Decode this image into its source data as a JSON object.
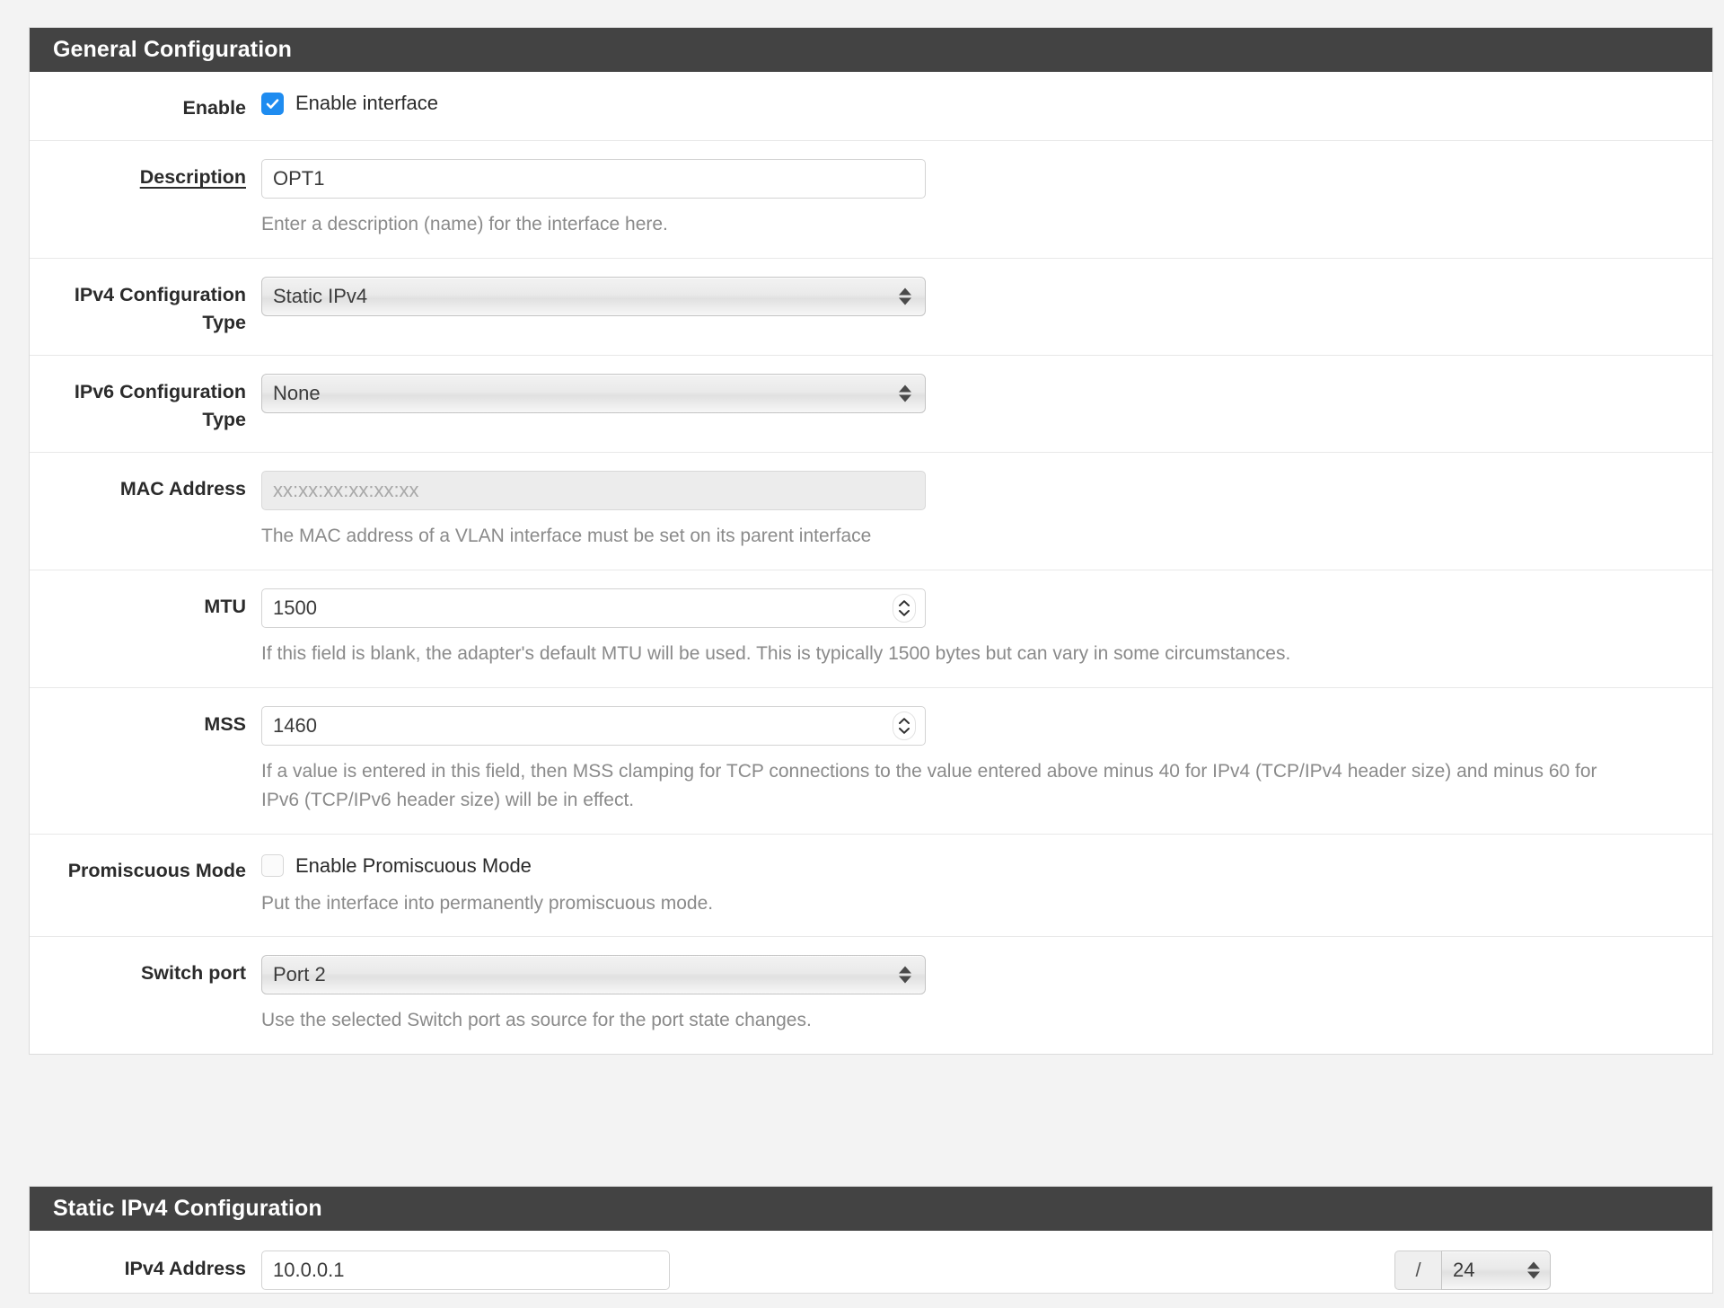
{
  "general_section": {
    "title": "General Configuration",
    "rows": {
      "enable": {
        "label": "Enable",
        "checkbox_label": "Enable interface",
        "checked": true
      },
      "description": {
        "label": "Description",
        "value": "OPT1",
        "help": "Enter a description (name) for the interface here."
      },
      "ipv4_config_type": {
        "label": "IPv4 Configuration Type",
        "value": "Static IPv4"
      },
      "ipv6_config_type": {
        "label": "IPv6 Configuration Type",
        "value": "None"
      },
      "mac_address": {
        "label": "MAC Address",
        "placeholder": "xx:xx:xx:xx:xx:xx",
        "value": "",
        "help": "The MAC address of a VLAN interface must be set on its parent interface"
      },
      "mtu": {
        "label": "MTU",
        "value": "1500",
        "help": "If this field is blank, the adapter's default MTU will be used. This is typically 1500 bytes but can vary in some circumstances."
      },
      "mss": {
        "label": "MSS",
        "value": "1460",
        "help": "If a value is entered in this field, then MSS clamping for TCP connections to the value entered above minus 40 for IPv4 (TCP/IPv4 header size) and minus 60 for IPv6 (TCP/IPv6 header size) will be in effect."
      },
      "promiscuous_mode": {
        "label": "Promiscuous Mode",
        "checkbox_label": "Enable Promiscuous Mode",
        "checked": false,
        "help": "Put the interface into permanently promiscuous mode."
      },
      "switch_port": {
        "label": "Switch port",
        "value": "Port 2",
        "help": "Use the selected Switch port as source for the port state changes."
      }
    }
  },
  "static_ipv4_section": {
    "title": "Static IPv4 Configuration",
    "rows": {
      "ipv4_address": {
        "label": "IPv4 Address",
        "value": "10.0.0.1",
        "prefix_separator": "/",
        "prefix_value": "24"
      }
    }
  },
  "colors": {
    "header_bg": "#434343",
    "accent_checkbox": "#1f8cf0",
    "page_bg": "#f3f3f3"
  }
}
